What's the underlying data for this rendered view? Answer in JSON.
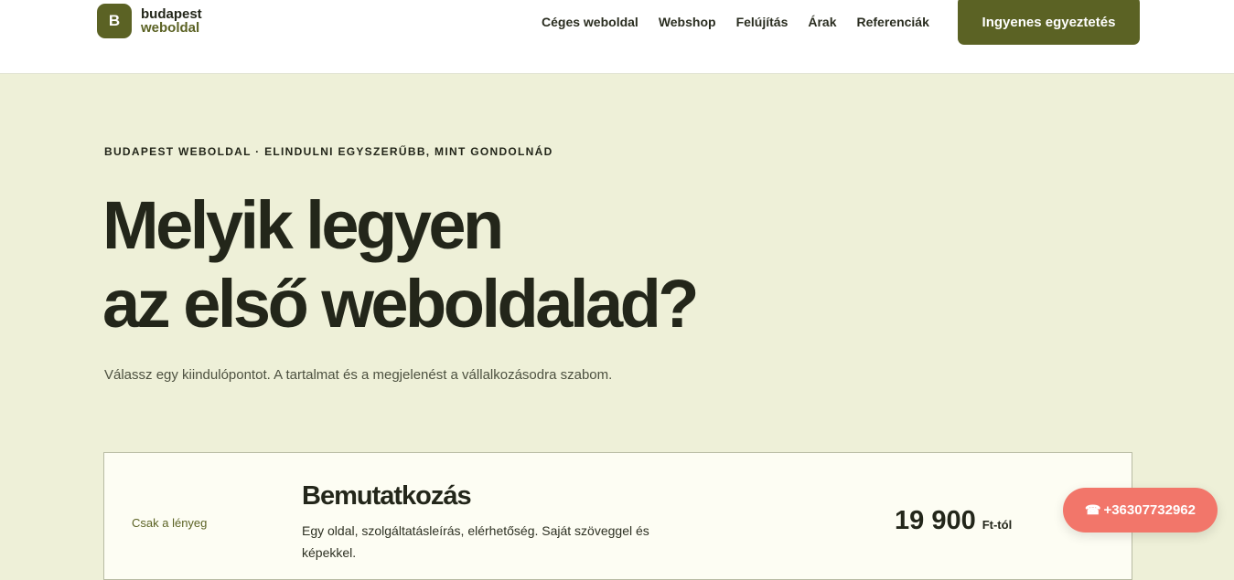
{
  "header": {
    "logo_letter": "B",
    "logo_line1": "budapest",
    "logo_line2": "weboldal",
    "nav": [
      "Céges weboldal",
      "Webshop",
      "Felújítás",
      "Árak",
      "Referenciák"
    ],
    "cta_label": "Ingyenes egyeztetés"
  },
  "hero": {
    "eyebrow": "BUDAPEST WEBOLDAL · ELINDULNI EGYSZERŰBB, MINT GONDOLNÁD",
    "headline_line1": "Melyik legyen",
    "headline_line2": "az első weboldalad?",
    "subtitle": "Válassz egy kiindulópontot. A tartalmat és a megjelenést a vállalkozásodra szabom."
  },
  "card": {
    "tag": "Csak a lényeg",
    "title": "Bemutatkozás",
    "description": "Egy oldal, szolgáltatásleírás, elérhetőség. Saját szöveggel és képekkel.",
    "price": "19 900",
    "price_unit": "Ft-tól"
  },
  "phone": {
    "icon": "phone-icon",
    "label": "+36307732962"
  },
  "colors": {
    "brand": "#5b6224",
    "background": "#eef0d8",
    "phone": "#f2766a"
  }
}
